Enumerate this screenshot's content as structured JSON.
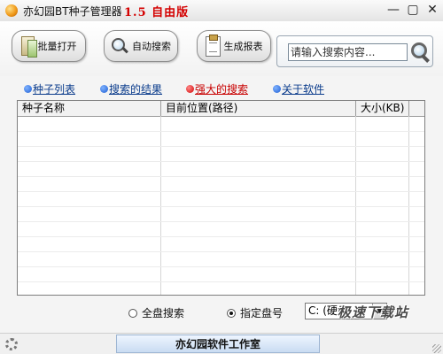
{
  "window": {
    "title": "亦幻园BT种子管理器",
    "version": "1.5 自由版",
    "controls": {
      "minimize": "—",
      "maximize": "▢",
      "close": "✕"
    }
  },
  "toolbar": {
    "batch_open_label": "批量打开",
    "auto_search_label": "自动搜索",
    "report_label": "生成报表",
    "search_placeholder": "请输入搜索内容..."
  },
  "tabs": [
    {
      "label": "种子列表"
    },
    {
      "label": "搜索的结果"
    },
    {
      "label": "强大的搜索"
    },
    {
      "label": "关于软件"
    }
  ],
  "table": {
    "columns": [
      "种子名称",
      "目前位置(路径)",
      "大小(KB)",
      ""
    ]
  },
  "bottom": {
    "radio_all": "全盘搜索",
    "radio_drive": "指定盘号",
    "drive_value": "C: (硬盘)",
    "watermark": "极速下载站"
  },
  "status": {
    "label": "亦幻园软件工作室"
  },
  "colors": {
    "active_tab": "#c80000",
    "tab_link": "#0b3c8c",
    "version_text": "#d40000"
  }
}
